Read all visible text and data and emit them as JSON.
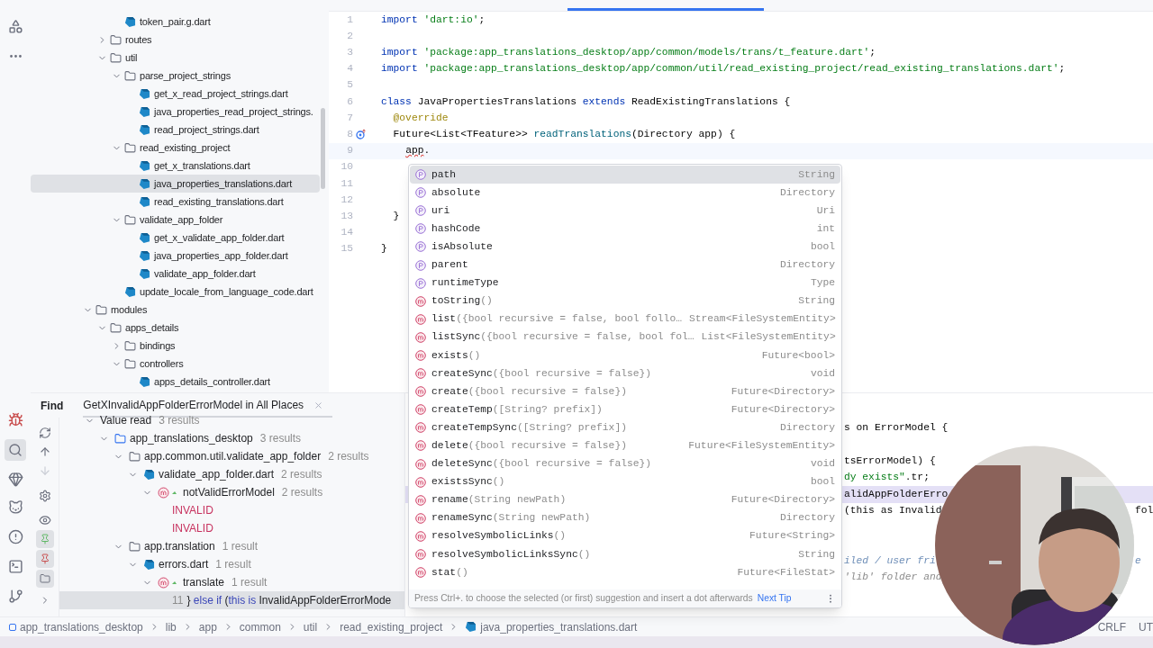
{
  "project_tree": [
    {
      "children": [
        {
          "children": [
            {
              "name": "token_pair.g.dart",
              "kind": "file",
              "selected": false
            }
          ]
        },
        {
          "name": "routes",
          "kind": "folder",
          "expanded": false,
          "selected": false
        },
        {
          "name": "util",
          "kind": "folder",
          "expanded": true,
          "selected": false,
          "children": [
            {
              "name": "parse_project_strings",
              "kind": "folder",
              "expanded": true,
              "selected": false,
              "children": [
                {
                  "name": "get_x_read_project_strings.dart",
                  "kind": "file",
                  "selected": false
                },
                {
                  "name": "java_properties_read_project_strings.",
                  "kind": "file",
                  "selected": false
                },
                {
                  "name": "read_project_strings.dart",
                  "kind": "file",
                  "selected": false
                }
              ]
            },
            {
              "name": "read_existing_project",
              "kind": "folder",
              "expanded": true,
              "selected": false,
              "children": [
                {
                  "name": "get_x_translations.dart",
                  "kind": "file",
                  "selected": false
                },
                {
                  "name": "java_properties_translations.dart",
                  "kind": "file",
                  "selected": true
                },
                {
                  "name": "read_existing_translations.dart",
                  "kind": "file",
                  "selected": false
                }
              ]
            },
            {
              "name": "validate_app_folder",
              "kind": "folder",
              "expanded": true,
              "selected": false,
              "children": [
                {
                  "name": "get_x_validate_app_folder.dart",
                  "kind": "file",
                  "selected": false
                },
                {
                  "name": "java_properties_app_folder.dart",
                  "kind": "file",
                  "selected": false
                },
                {
                  "name": "validate_app_folder.dart",
                  "kind": "file",
                  "selected": false
                }
              ]
            },
            {
              "name": "update_locale_from_language_code.dart",
              "kind": "file",
              "selected": false
            }
          ]
        }
      ]
    },
    {
      "name": "modules",
      "kind": "folder",
      "expanded": true,
      "selected": false,
      "children": [
        {
          "name": "apps_details",
          "kind": "folder",
          "expanded": true,
          "selected": false,
          "children": [
            {
              "name": "bindings",
              "kind": "folder",
              "expanded": false,
              "selected": false
            },
            {
              "name": "controllers",
              "kind": "folder",
              "expanded": true,
              "selected": false,
              "children": [
                {
                  "name": "apps_details_controller.dart",
                  "kind": "file",
                  "selected": false
                }
              ]
            }
          ]
        }
      ]
    }
  ],
  "editor": {
    "lines": [
      {
        "number": "1",
        "current": false,
        "gutter_icon": false,
        "tokens": [
          {
            "kind": "keyword",
            "text": "import"
          },
          {
            "kind": "string",
            "text": " 'dart:io'"
          },
          {
            "kind": "plain",
            "text": ";"
          }
        ]
      },
      {
        "number": "2",
        "current": false,
        "gutter_icon": false
      },
      {
        "number": "3",
        "current": false,
        "gutter_icon": false,
        "tokens": [
          {
            "kind": "keyword",
            "text": "import"
          },
          {
            "kind": "string",
            "text": " 'package:app_translations_desktop/app/common/models/trans/t_feature.dart'"
          },
          {
            "kind": "plain",
            "text": ";"
          }
        ]
      },
      {
        "number": "4",
        "current": false,
        "gutter_icon": false,
        "tokens": [
          {
            "kind": "keyword",
            "text": "import"
          },
          {
            "kind": "string",
            "text": " 'package:app_translations_desktop/app/common/util/read_existing_project/read_existing_translations.dart'"
          },
          {
            "kind": "plain",
            "text": ";"
          }
        ]
      },
      {
        "number": "5",
        "current": false,
        "gutter_icon": false
      },
      {
        "number": "6",
        "current": false,
        "gutter_icon": false,
        "tokens": [
          {
            "kind": "keyword",
            "text": "class"
          },
          {
            "kind": "plain",
            "text": " JavaPropertiesTranslations "
          },
          {
            "kind": "keyword",
            "text": "extends"
          },
          {
            "kind": "plain",
            "text": " ReadExistingTranslations {"
          }
        ]
      },
      {
        "number": "7",
        "current": false,
        "gutter_icon": false,
        "tokens": [
          {
            "kind": "annotation",
            "text": "  @override"
          }
        ]
      },
      {
        "number": "8",
        "current": false,
        "gutter_icon": true,
        "tokens": [
          {
            "kind": "plain",
            "text": "  Future<List<TFeature>> "
          },
          {
            "kind": "method",
            "text": "readTranslations"
          },
          {
            "kind": "plain",
            "text": "(Directory app) {"
          }
        ]
      },
      {
        "number": "9",
        "current": true,
        "gutter_icon": false,
        "tokens": [
          {
            "kind": "error",
            "text": "    app"
          },
          {
            "kind": "plain",
            "text": "."
          }
        ]
      },
      {
        "number": "10",
        "current": false,
        "gutter_icon": false
      },
      {
        "number": "11",
        "current": false,
        "gutter_icon": false
      },
      {
        "number": "12",
        "current": false,
        "gutter_icon": false
      },
      {
        "number": "13",
        "current": false,
        "gutter_icon": false,
        "tokens": [
          {
            "kind": "plain",
            "text": "  }"
          }
        ]
      },
      {
        "number": "14",
        "current": false,
        "gutter_icon": false
      },
      {
        "number": "15",
        "current": false,
        "gutter_icon": false,
        "tokens": [
          {
            "kind": "plain",
            "text": "}"
          }
        ]
      }
    ]
  },
  "completion": {
    "items": [
      {
        "kind": "property",
        "name": "path",
        "type": "String",
        "selected": true
      },
      {
        "kind": "property",
        "name": "absolute",
        "type": "Directory",
        "selected": false
      },
      {
        "kind": "property",
        "name": "uri",
        "type": "Uri",
        "selected": false
      },
      {
        "kind": "property",
        "name": "hashCode",
        "type": "int",
        "selected": false
      },
      {
        "kind": "property",
        "name": "isAbsolute",
        "type": "bool",
        "selected": false
      },
      {
        "kind": "property",
        "name": "parent",
        "type": "Directory",
        "selected": false
      },
      {
        "kind": "property",
        "name": "runtimeType",
        "type": "Type",
        "selected": false
      },
      {
        "kind": "method",
        "name": "toString",
        "params": "()",
        "type": "String",
        "selected": false
      },
      {
        "kind": "method",
        "name": "list",
        "params": "({bool recursive = false, bool follo…",
        "type": "Stream<FileSystemEntity>",
        "selected": false
      },
      {
        "kind": "method",
        "name": "listSync",
        "params": "({bool recursive = false, bool fol…",
        "type": "List<FileSystemEntity>",
        "selected": false
      },
      {
        "kind": "method",
        "name": "exists",
        "params": "()",
        "type": "Future<bool>",
        "selected": false
      },
      {
        "kind": "method",
        "name": "createSync",
        "params": "({bool recursive = false})",
        "type": "void",
        "selected": false
      },
      {
        "kind": "method",
        "name": "create",
        "params": "({bool recursive = false})",
        "type": "Future<Directory>",
        "selected": false
      },
      {
        "kind": "method",
        "name": "createTemp",
        "params": "([String? prefix])",
        "type": "Future<Directory>",
        "selected": false
      },
      {
        "kind": "method",
        "name": "createTempSync",
        "params": "([String? prefix])",
        "type": "Directory",
        "selected": false
      },
      {
        "kind": "method",
        "name": "delete",
        "params": "({bool recursive = false})",
        "type": "Future<FileSystemEntity>",
        "selected": false
      },
      {
        "kind": "method",
        "name": "deleteSync",
        "params": "({bool recursive = false})",
        "type": "void",
        "selected": false
      },
      {
        "kind": "method",
        "name": "existsSync",
        "params": "()",
        "type": "bool",
        "selected": false
      },
      {
        "kind": "method",
        "name": "rename",
        "params": "(String newPath)",
        "type": "Future<Directory>",
        "selected": false
      },
      {
        "kind": "method",
        "name": "renameSync",
        "params": "(String newPath)",
        "type": "Directory",
        "selected": false
      },
      {
        "kind": "method",
        "name": "resolveSymbolicLinks",
        "params": "()",
        "type": "Future<String>",
        "selected": false
      },
      {
        "kind": "method",
        "name": "resolveSymbolicLinksSync",
        "params": "()",
        "type": "String",
        "selected": false
      },
      {
        "kind": "method",
        "name": "stat",
        "params": "()",
        "type": "Future<FileStat>",
        "selected": false
      }
    ],
    "hint": "Press Ctrl+. to choose the selected (or first) suggestion and insert a dot afterwards",
    "next_tip": "Next Tip"
  },
  "find_panel": {
    "label": "Find",
    "tab_title": "GetXInvalidAppFolderErrorModel in All Places",
    "results": [
      {
        "kind": "group",
        "label": "Value read",
        "count": "3 results",
        "expanded": true,
        "children": [
          {
            "kind": "module",
            "label": "app_translations_desktop",
            "count": "3 results",
            "expanded": true,
            "children": [
              {
                "kind": "package",
                "label": "app.common.util.validate_app_folder",
                "count": "2 results",
                "expanded": true,
                "children": [
                  {
                    "kind": "file",
                    "label": "validate_app_folder.dart",
                    "count": "2 results",
                    "expanded": true,
                    "children": [
                      {
                        "kind": "method",
                        "label": "notValidErrorModel",
                        "count": "2 results",
                        "expanded": true,
                        "children": [
                          {
                            "kind": "usage",
                            "label": "INVALID"
                          },
                          {
                            "kind": "usage",
                            "label": "INVALID"
                          }
                        ]
                      }
                    ]
                  }
                ]
              },
              {
                "kind": "package",
                "label": "app.translation",
                "count": "1 result",
                "expanded": true,
                "children": [
                  {
                    "kind": "file",
                    "label": "errors.dart",
                    "count": "1 result",
                    "expanded": true,
                    "children": [
                      {
                        "kind": "method",
                        "label": "translate",
                        "count": "1 result",
                        "expanded": true,
                        "children": [
                          {
                            "kind": "line",
                            "number": "11",
                            "selected": true,
                            "tokens": [
                              {
                                "kind": "plain",
                                "text": "}"
                              },
                              {
                                "kind": "keyword",
                                "text": " else if"
                              },
                              {
                                "kind": "plain",
                                "text": " ("
                              },
                              {
                                "kind": "keyword",
                                "text": "this is"
                              },
                              {
                                "kind": "plain",
                                "text": " InvalidAppFolderErrorMode"
                              }
                            ]
                          }
                        ]
                      }
                    ]
                  }
                ]
              }
            ]
          }
        ]
      }
    ]
  },
  "side_code": [
    {
      "lines": [
        {
          "highlighted": false,
          "tokens": [
            {
              "kind": "plain",
              "text": "s on ErrorModel {"
            }
          ]
        }
      ]
    },
    {
      "lines": [
        {
          "highlighted": false,
          "tokens": [
            {
              "kind": "plain",
              "text": "tsErrorModel) {"
            }
          ]
        },
        {
          "highlighted": false,
          "tokens": [
            {
              "kind": "string",
              "text": "dy exists\""
            },
            {
              "kind": "plain",
              "text": ".tr;"
            }
          ]
        },
        {
          "highlighted": true,
          "tokens": [
            {
              "kind": "plain",
              "text": "alidAppFolderErro"
            }
          ]
        },
        {
          "highlighted": false,
          "tokens": [
            {
              "kind": "plain",
              "text": "(this as Invalid"
            }
          ],
          "right": {
            "kind": "plain",
            "text": "fol"
          }
        }
      ]
    },
    {
      "lines": [
        {
          "highlighted": false,
          "tokens": [
            {
              "kind": "doc",
              "text": "iled / user fri"
            }
          ],
          "right": {
            "kind": "doc",
            "text": "e"
          }
        },
        {
          "highlighted": false,
          "tokens": [
            {
              "kind": "comment",
              "text": "'lib' folder and"
            }
          ]
        }
      ]
    }
  ],
  "breadcrumb": [
    "app_translations_desktop",
    "lib",
    "app",
    "common",
    "util",
    "read_existing_project",
    "java_properties_translations.dart"
  ],
  "status_items": [
    "CRLF",
    "UT"
  ],
  "webcam": {
    "kind": "picture"
  }
}
